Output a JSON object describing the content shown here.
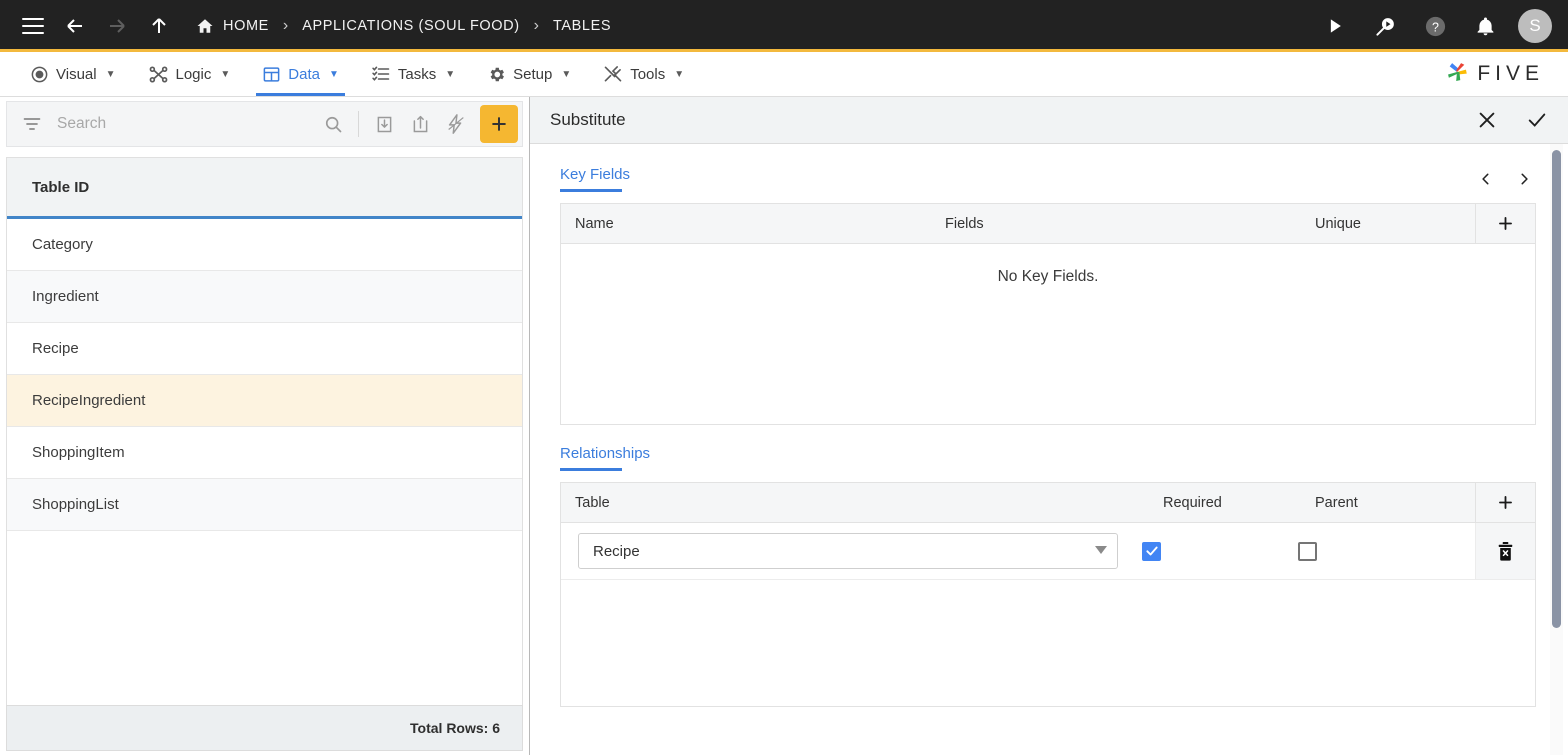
{
  "topbar": {
    "menu_icon": "hamburger-icon",
    "back_icon": "arrow-left-icon",
    "forward_icon": "arrow-right-icon",
    "up_icon": "arrow-up-icon",
    "breadcrumbs": [
      {
        "label": "HOME",
        "icon": "home-icon"
      },
      {
        "label": "APPLICATIONS (SOUL FOOD)",
        "icon": ""
      },
      {
        "label": "TABLES",
        "icon": ""
      }
    ],
    "separator": "›",
    "actions": [
      {
        "name": "run-icon"
      },
      {
        "name": "debug-search-icon"
      },
      {
        "name": "help-icon"
      },
      {
        "name": "notifications-bell-icon"
      }
    ],
    "avatar_initial": "S"
  },
  "menubar": {
    "items": [
      {
        "label": "Visual",
        "icon": "eye-icon",
        "active": false
      },
      {
        "label": "Logic",
        "icon": "logic-nodes-icon",
        "active": false
      },
      {
        "label": "Data",
        "icon": "table-grid-icon",
        "active": true
      },
      {
        "label": "Tasks",
        "icon": "checklist-icon",
        "active": false
      },
      {
        "label": "Setup",
        "icon": "gear-icon",
        "active": false
      },
      {
        "label": "Tools",
        "icon": "tools-icon",
        "active": false
      }
    ],
    "caret": "▼",
    "brand": "FIVE"
  },
  "sidebar": {
    "search": {
      "placeholder": "Search",
      "value": ""
    },
    "toolbar": [
      {
        "name": "filter-icon"
      },
      {
        "name": "search-icon"
      },
      {
        "name": "import-icon"
      },
      {
        "name": "export-icon"
      },
      {
        "name": "lightning-icon"
      },
      {
        "name": "add-button",
        "label": "+"
      }
    ],
    "column_header": "Table ID",
    "rows": [
      {
        "label": "Category",
        "selected": false
      },
      {
        "label": "Ingredient",
        "selected": false
      },
      {
        "label": "Recipe",
        "selected": false
      },
      {
        "label": "RecipeIngredient",
        "selected": true
      },
      {
        "label": "ShoppingItem",
        "selected": false
      },
      {
        "label": "ShoppingList",
        "selected": false
      }
    ],
    "footer": "Total Rows: 6"
  },
  "main": {
    "title": "Substitute",
    "close_icon": "close-icon",
    "confirm_icon": "check-icon",
    "prev_icon": "chevron-left-icon",
    "next_icon": "chevron-right-icon",
    "key_fields": {
      "tab_label": "Key Fields",
      "columns": [
        "Name",
        "Fields",
        "Unique"
      ],
      "add_label": "+",
      "empty_message": "No Key Fields."
    },
    "relationships": {
      "tab_label": "Relationships",
      "columns": [
        "Table",
        "Required",
        "Parent"
      ],
      "add_label": "+",
      "rows": [
        {
          "table": "Recipe",
          "required": true,
          "parent": false,
          "delete_icon": "delete-icon"
        }
      ]
    }
  },
  "colors": {
    "accent_orange": "#F5B731",
    "accent_blue": "#3B7DDD",
    "checkbox_blue": "#4285F4",
    "topbar_dark": "#222222",
    "selected_row": "#FDF3E0"
  }
}
